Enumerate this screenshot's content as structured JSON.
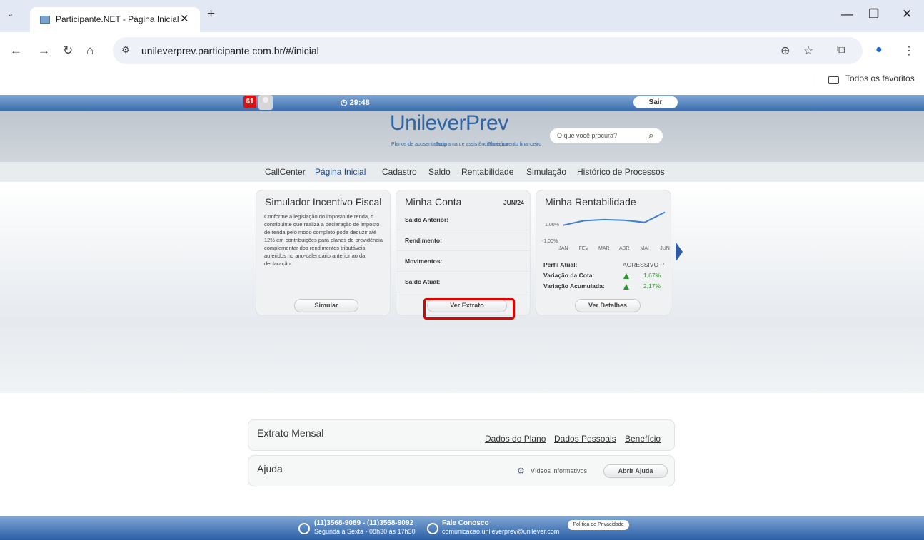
{
  "browser": {
    "tab_title": "Participante.NET - Página Inicial",
    "tab_close": "✕",
    "new_tab": "+",
    "url": "unileverprev.participante.com.br/#/inicial",
    "bookmarks_folder": "Todos os favoritos"
  },
  "header": {
    "notifications_count": "61",
    "session_timer": "29:48",
    "logout_label": "Sair",
    "logo_text": "UnileverPrev",
    "logo_sub": [
      "Planos de aposentadoria",
      "Programa de assistência médica",
      "Planejamento financeiro"
    ],
    "search_placeholder": "O que você procura?"
  },
  "nav": {
    "items": [
      "CallCenter",
      "Página Inicial",
      "Cadastro",
      "Saldo",
      "Rentabilidade",
      "Simulação",
      "Histórico de Processos"
    ],
    "active": "Página Inicial"
  },
  "cards": {
    "simulador": {
      "title": "Simulador Incentivo Fiscal",
      "text": "Conforme a legislação do imposto de renda, o contribuinte que realiza a declaração de imposto de renda pelo modo completo pode deduzir até 12% em contribuições para planos de previdência complementar dos rendimentos tributáveis auferidos no ano-calendário anterior ao da declaração.",
      "button": "Simular"
    },
    "conta": {
      "title": "Minha Conta",
      "period": "JUN/24",
      "rows": [
        "Saldo Anterior:",
        "Rendimento:",
        "Movimentos:",
        "Saldo Atual:"
      ],
      "button": "Ver Extrato"
    },
    "rentabilidade": {
      "title": "Minha Rentabilidade",
      "ytick_top": "1,00%",
      "ytick_bottom": "-1,00%",
      "perfil_label": "Perfil Atual:",
      "perfil_value": "AGRESSIVO P",
      "var_cota_label": "Variação da Cota:",
      "var_cota_value": "1,67%",
      "var_acum_label": "Variação Acumulada:",
      "var_acum_value": "2,17%",
      "button": "Ver Detalhes"
    }
  },
  "chart_data": {
    "type": "line",
    "categories": [
      "JAN",
      "FEV",
      "MAR",
      "ABR",
      "MAI",
      "JUN"
    ],
    "values": [
      0.5,
      0.9,
      1.0,
      0.95,
      0.75,
      1.67
    ],
    "ylim": [
      -1.0,
      1.7
    ],
    "grid": false
  },
  "panels": {
    "extrato": {
      "title": "Extrato Mensal",
      "links": [
        "Dados do Plano",
        "Dados Pessoais",
        "Benefício"
      ]
    },
    "ajuda": {
      "title": "Ajuda",
      "videos": "Vídeos informativos",
      "button": "Abrir Ajuda"
    }
  },
  "footer": {
    "phones": "(11)3568-9089 - (11)3568-9092",
    "hours": "Segunda a Sexta - 08h30 às 17h30",
    "contact": "Fale Conosco",
    "email": "comunicacao.unileverprev@unilever.com",
    "privacy": "Política de Privacidade"
  },
  "colors": {
    "accent_blue": "#2f66a6",
    "highlight_red": "#e00000",
    "positive_green": "#2e9a2e"
  }
}
